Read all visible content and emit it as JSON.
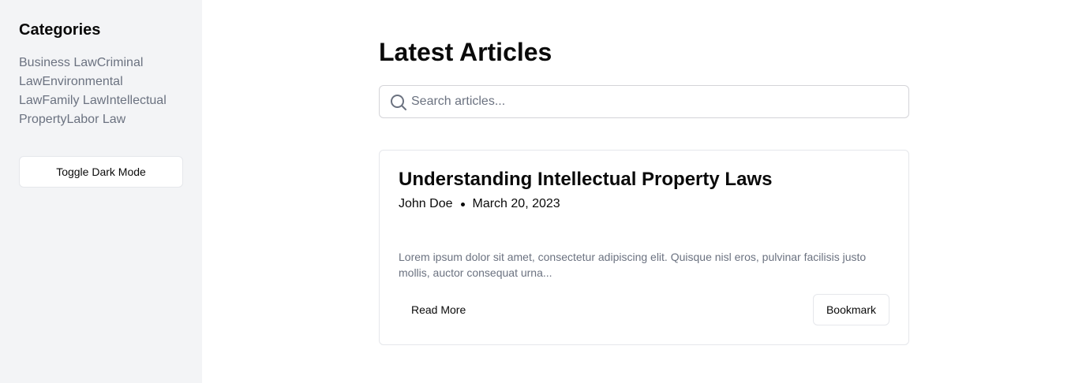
{
  "sidebar": {
    "title": "Categories",
    "categories": [
      "Business Law",
      "Criminal Law",
      "Environmental Law",
      "Family Law",
      "Intellectual Property",
      "Labor Law"
    ],
    "toggle_label": "Toggle Dark Mode"
  },
  "main": {
    "title": "Latest Articles",
    "search": {
      "placeholder": "Search articles...",
      "value": "",
      "icon": "search-icon"
    },
    "article": {
      "title": "Understanding Intellectual Property Laws",
      "author": "John Doe",
      "date": "March 20, 2023",
      "excerpt": "Lorem ipsum dolor sit amet, consectetur adipiscing elit. Quisque nisl eros, pulvinar facilisis justo mollis, auctor consequat urna...",
      "read_more_label": "Read More",
      "bookmark_label": "Bookmark"
    }
  }
}
